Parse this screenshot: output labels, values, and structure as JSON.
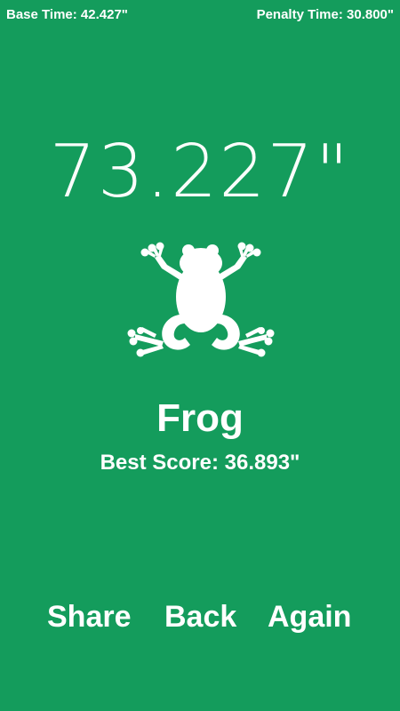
{
  "header": {
    "base_time": "Base Time: 42.427\"",
    "penalty_time": "Penalty Time: 30.800\""
  },
  "result": {
    "total_time": "73.227\"",
    "animal": "Frog",
    "best_score": "Best Score: 36.893\""
  },
  "icon": {
    "name": "frog-icon",
    "color": "#ffffff"
  },
  "actions": {
    "share": "Share",
    "back": "Back",
    "again": "Again"
  },
  "theme": {
    "background": "#149c5c",
    "text": "#ffffff"
  }
}
